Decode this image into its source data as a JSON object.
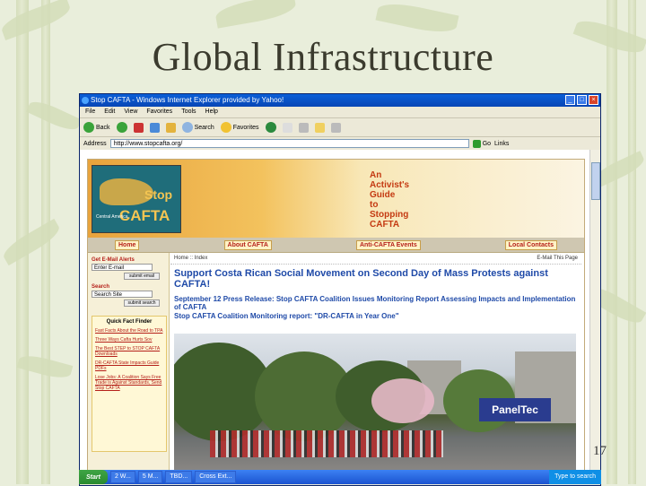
{
  "slide": {
    "title": "Global Infrastructure",
    "page_number": "17"
  },
  "browser": {
    "window_title": "Stop CAFTA - Windows Internet Explorer provided by Yahoo!",
    "menu": [
      "File",
      "Edit",
      "View",
      "Favorites",
      "Tools",
      "Help"
    ],
    "toolbar": {
      "back": "Back",
      "search": "Search",
      "favorites": "Favorites"
    },
    "address_label": "Address",
    "address_value": "http://www.stopcafta.org/",
    "go_label": "Go",
    "links_label": "Links"
  },
  "site": {
    "logo_stop": "Stop",
    "logo_cafta": "CAFTA",
    "logo_region": "Central America",
    "tagline": [
      "An",
      "Activist's",
      "Guide",
      "to",
      "Stopping",
      "CAFTA"
    ],
    "nav": [
      "Home",
      "About CAFTA",
      "Anti-CAFTA Events",
      "Local Contacts"
    ],
    "sidebar": {
      "email_label": "Get E-Mail Alerts",
      "email_value": "Enter E-mail",
      "email_button": "submit email",
      "search_label": "Search",
      "search_value": "Search Site",
      "search_button": "submit search",
      "quick_heading": "Quick Fact Finder",
      "quick_links": [
        "Fast Facts About the Road to TPA",
        "Three Ways Cafta Hurts Sov",
        "The Best STEP to STOP CAFTA Downloads",
        "DR-CAFTA State Impacts Guide PDFs",
        "Lose Jobs: A Coalition Says Free Trade is Against Standards, Send Stop CAFTA"
      ]
    },
    "breadcrumb": "Home :: Index",
    "mail_to_friend": "E-Mail This Page",
    "headline": "Support Costa Rican Social Movement on Second Day of Mass Protests against CAFTA!",
    "subheads": [
      "September 12 Press Release: Stop CAFTA Coalition Issues Monitoring Report Assessing Impacts and Implementation of CAFTA",
      "Stop CAFTA Coalition Monitoring report: \"DR-CAFTA in Year One\""
    ],
    "photo_sign": "PanelTec"
  },
  "taskbar": {
    "start": "Start",
    "tasks": [
      "2 W...",
      "5 M...",
      "TBD...",
      "Cross Ext..."
    ],
    "search_placeholder": "Type to search"
  }
}
